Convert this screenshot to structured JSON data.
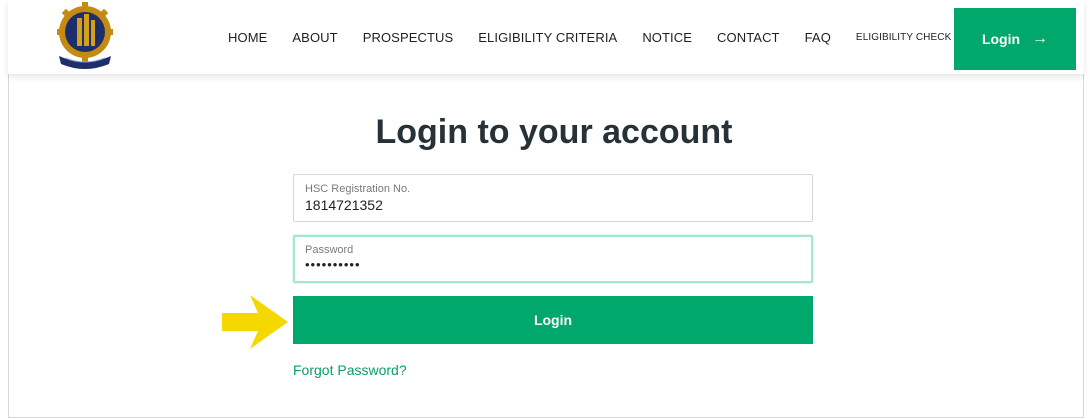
{
  "nav": {
    "links": [
      "HOME",
      "ABOUT",
      "PROSPECTUS",
      "ELIGIBILITY CRITERIA",
      "NOTICE",
      "CONTACT",
      "FAQ"
    ],
    "small_link": "ELIGIBILITY CHECK & APPLY",
    "login_label": "Login",
    "login_arrow": "→",
    "logo_icon": "university-crest-logo"
  },
  "page": {
    "heading": "Login to your account"
  },
  "form": {
    "registration": {
      "label": "HSC Registration No.",
      "value": "1814721352"
    },
    "password": {
      "label": "Password",
      "value": "••••••••••"
    },
    "submit_label": "Login",
    "forgot_label": "Forgot Password?"
  },
  "colors": {
    "accent": "#00a86b",
    "heading": "#263238",
    "pointer": "#f5d800"
  },
  "annotation": {
    "icon": "yellow-arrow-icon"
  }
}
